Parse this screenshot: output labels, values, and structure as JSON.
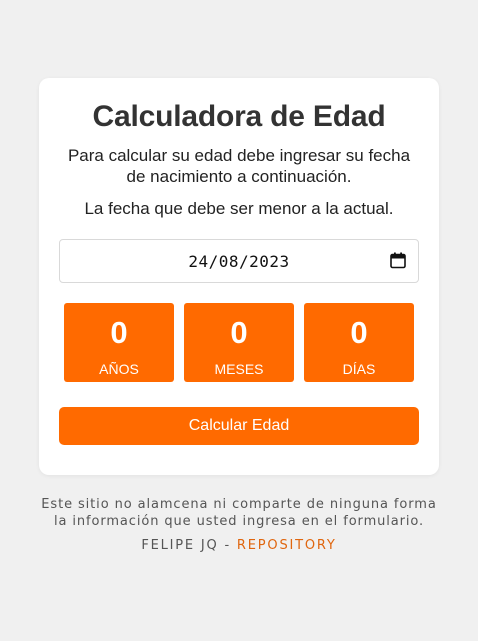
{
  "card": {
    "title": "Calculadora de Edad",
    "description": "Para calcular su edad debe ingresar su fecha de nacimiento a continuación.",
    "hint": "La fecha que debe ser menor a la actual."
  },
  "date_input": {
    "value": "24/08/2023",
    "icon": "calendar-icon"
  },
  "results": [
    {
      "value": "0",
      "label": "AÑOS"
    },
    {
      "value": "0",
      "label": "MESES"
    },
    {
      "value": "0",
      "label": "DÍAS"
    }
  ],
  "button": {
    "label": "Calcular Edad"
  },
  "footer": {
    "line1": "Este sitio no alamcena ni comparte de ninguna forma",
    "line2": "la información que usted ingresa en el formulario.",
    "author": "FELIPE JQ",
    "separator": " - ",
    "link": "REPOSITORY"
  },
  "colors": {
    "accent": "#ff6a00",
    "background": "#f0f0f0",
    "card": "#ffffff",
    "link": "#e0660f"
  }
}
